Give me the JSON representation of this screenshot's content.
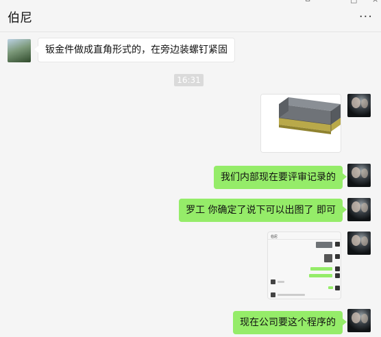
{
  "header": {
    "title": "伯尼",
    "more_label": "···"
  },
  "window": {
    "pin": "ㅁ",
    "minimize": "−",
    "maximize": "□",
    "close": "×"
  },
  "messages": {
    "m1": "钣金件做成直角形式的，在旁边装螺钉紧固",
    "time": "16:31",
    "m3": "我们内部现在要评审记录的",
    "m4": "罗工 你确定了说下可以出图了  即可",
    "m6": "现在公司要这个程序的"
  },
  "screenshot": {
    "header": "伯尼"
  },
  "colors": {
    "outgoing_bubble": "#95ec69",
    "incoming_bubble": "#ffffff",
    "background": "#f5f5f5",
    "part_body": "#6f7378",
    "part_flange": "#b9a94a"
  }
}
